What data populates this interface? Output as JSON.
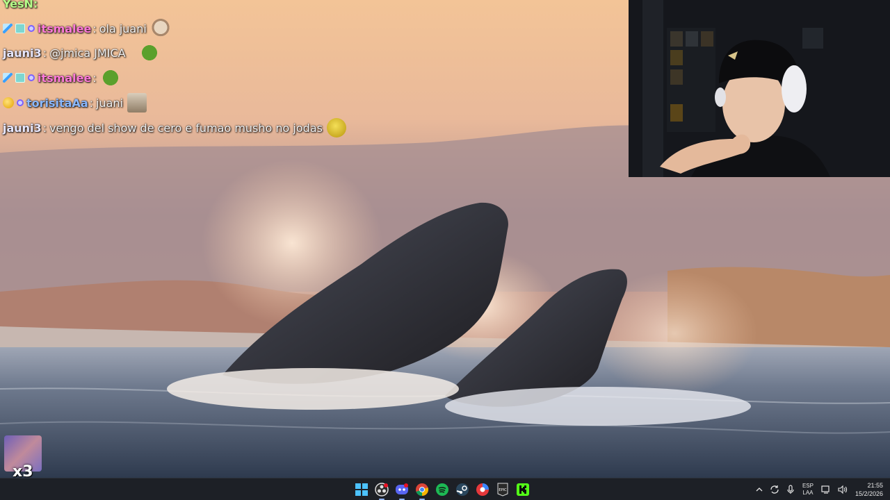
{
  "chat": {
    "top_partial": {
      "user": "YesN:",
      "color": "#b6ff8a"
    },
    "messages": [
      {
        "user": "itsmalee",
        "color": "#ff7ad9",
        "text": "ola juani",
        "badges": [
          "sword-badge",
          "sub-badge",
          "gift-badge"
        ],
        "emote": "dog-emote"
      },
      {
        "user": "jauni3",
        "color": "#e8e8ff",
        "text": "@jmica JMICA",
        "badges": [],
        "emote": "pepe-emote"
      },
      {
        "user": "itsmalee",
        "color": "#ff7ad9",
        "text": "",
        "badges": [
          "sword-badge",
          "sub-badge",
          "gift-badge"
        ],
        "emote": "pepe-emote"
      },
      {
        "user": "torisitaAa",
        "color": "#8ab8ff",
        "text": "juani",
        "badges": [
          "coin-badge",
          "gift-badge"
        ],
        "emote": "cat-emote"
      },
      {
        "user": "jauni3",
        "color": "#e8e8ff",
        "text": "vengo del show de cero e fumao musho no jodas",
        "badges": [],
        "emote": "smirk-emote"
      }
    ]
  },
  "combo": {
    "count": "x3"
  },
  "taskbar": {
    "apps": [
      "windows-start-icon",
      "obs-icon",
      "discord-icon",
      "chrome-icon",
      "spotify-icon",
      "steam-icon",
      "browser-icon",
      "epic-games-icon",
      "kick-icon"
    ],
    "lang_line1": "ESP",
    "lang_line2": "LAA",
    "time": "21:55",
    "date": "15/2/2026"
  },
  "colors": {
    "taskbar": "#1d2026",
    "accent": "#53fc18"
  }
}
